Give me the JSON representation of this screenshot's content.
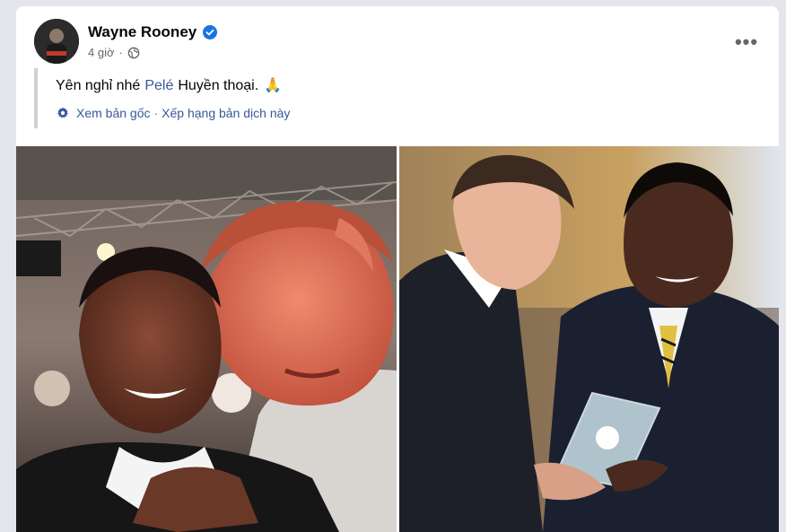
{
  "post": {
    "author": "Wayne Rooney",
    "verified": true,
    "time": "4 giờ",
    "audience_icon": "globe-icon",
    "text_before_mention": "Yên nghỉ nhé",
    "mention": "Pelé",
    "text_after_mention": "Huyền thoại.",
    "emoji": "🙏",
    "translation": {
      "see_original": "Xem bản gốc",
      "separator": "·",
      "rate_translation": "Xếp hạng bản dịch này"
    },
    "more_label": "•••"
  },
  "photos": [
    {
      "alt": "selfie-pele-rooney"
    },
    {
      "alt": "pele-presenting-award-to-rooney"
    }
  ],
  "colors": {
    "link": "#385898",
    "verified": "#1b74e4",
    "meta": "#65676b",
    "background": "#e4e6eb"
  }
}
